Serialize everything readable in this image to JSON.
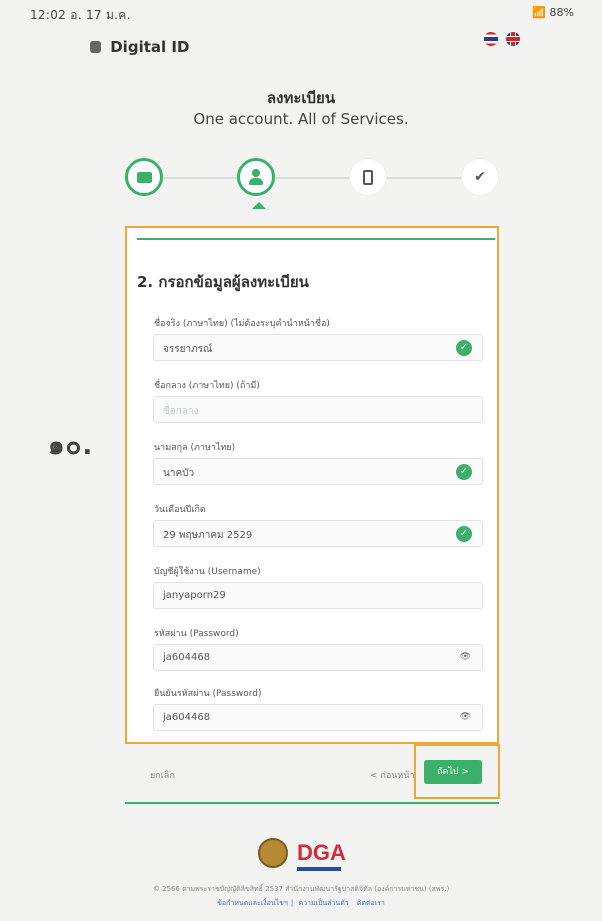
{
  "status_bar": {
    "time": "12:02",
    "date": "อ. 17 ม.ค.",
    "battery": "88%"
  },
  "app": {
    "brand": "Digital ID"
  },
  "header": {
    "title": "ลงทะเบียน",
    "subtitle": "One account. All of Services."
  },
  "stepper": {
    "steps": [
      {
        "icon": "card-icon",
        "state": "done"
      },
      {
        "icon": "user-icon",
        "state": "active"
      },
      {
        "icon": "phone-icon",
        "state": "pending"
      },
      {
        "icon": "check-icon",
        "state": "pending"
      }
    ],
    "check_glyph": "✔"
  },
  "form": {
    "heading": "2. กรอกข้อมูลผู้ลงทะเบียน",
    "fields": [
      {
        "label": "ชื่อจริง (ภาษาไทย) (ไม่ต้องระบุคำนำหน้าชื่อ)",
        "value": "จรรยาภรณ์",
        "placeholder": "",
        "valid": true
      },
      {
        "label": "ชื่อกลาง (ภาษาไทย) (ถ้ามี)",
        "value": "",
        "placeholder": "ชื่อกลาง",
        "valid": false
      },
      {
        "label": "นามสกุล (ภาษาไทย)",
        "value": "นาคบัว",
        "placeholder": "",
        "valid": true
      },
      {
        "label": "วันเดือนปีเกิด",
        "value": "29 พฤษภาคม 2529",
        "placeholder": "",
        "valid": true
      },
      {
        "label": "บัญชีผู้ใช้งาน (Username)",
        "value": "janyaporn29",
        "placeholder": "",
        "valid": false
      },
      {
        "label": "รหัสผ่าน (Password)",
        "value": "ja604468",
        "placeholder": "",
        "valid": false
      },
      {
        "label": "ยืนยันรหัสผ่าน (Password)",
        "value": "ja604468",
        "placeholder": "",
        "valid": false
      }
    ],
    "valid_glyph": "✓",
    "eye_glyph": "👁"
  },
  "annotation": {
    "side_number": "๑๐."
  },
  "actions": {
    "cancel": "ยกเลิก",
    "back": "< ก่อนหน้า",
    "next": "ถัดไป >"
  },
  "footer": {
    "logo_text": "DGA",
    "copyright": "© 2566 ตามพระราชบัญญัติลิขสิทธิ์ 2537 สำนักงานพัฒนารัฐบาลดิจิทัล (องค์การมหาชน) (สพร.)",
    "links": [
      "ข้อกำหนดและเงื่อนไขฯ",
      "ความเป็นส่วนตัว",
      "ติดต่อเรา"
    ]
  },
  "colors": {
    "accent": "#3ab06a",
    "highlight": "#f0a834",
    "dga_red": "#d42a3a"
  }
}
